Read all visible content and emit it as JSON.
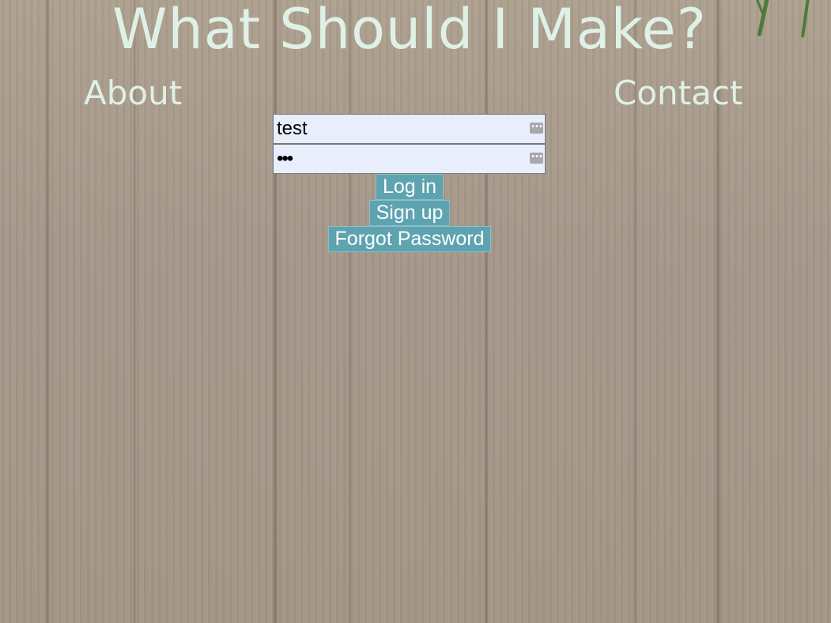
{
  "header": {
    "title": "What Should I Make?"
  },
  "nav": {
    "about_label": "About",
    "contact_label": "Contact"
  },
  "login": {
    "username_value": "test",
    "password_masked": "•••",
    "login_label": "Log in",
    "signup_label": "Sign up",
    "forgot_label": "Forgot Password",
    "autofill_glyph": "•••"
  },
  "colors": {
    "title_text": "#dff1e6",
    "button_bg": "#5da4b0",
    "field_bg": "#e8eefc",
    "background_wood": "#a89a8b"
  }
}
